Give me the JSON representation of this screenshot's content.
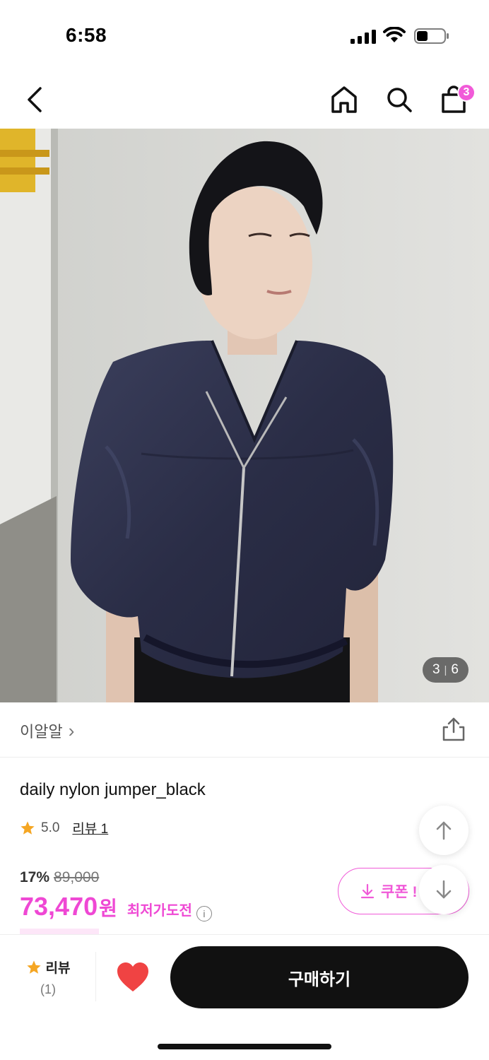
{
  "status_bar": {
    "time": "6:58",
    "icons": [
      "signal-icon",
      "wifi-icon",
      "battery-icon"
    ]
  },
  "nav": {
    "icons": [
      "back-icon",
      "home-icon",
      "search-icon",
      "shopping-bag-icon"
    ],
    "cart_count": "3"
  },
  "gallery": {
    "current": "3",
    "total": "6",
    "separator": "|"
  },
  "brand": {
    "name": "이알알",
    "chevron": "›"
  },
  "product": {
    "title": "daily nylon jumper_black",
    "rating": "5.0",
    "review_label": "리뷰 1",
    "discount_rate": "17%",
    "original_price": "89,000",
    "sale_price": "73,470",
    "currency": "원",
    "lowest_price_label": "최저가도전",
    "info_symbol": "i"
  },
  "coupon": {
    "label": "쿠폰 !"
  },
  "bottom_bar": {
    "review_label": "리뷰",
    "review_count": "(1)",
    "buy_label": "구매하기"
  },
  "colors": {
    "accent_pink": "#ef48d4",
    "star": "#f5a623",
    "heart": "#f04343",
    "buy_button": "#111111"
  }
}
